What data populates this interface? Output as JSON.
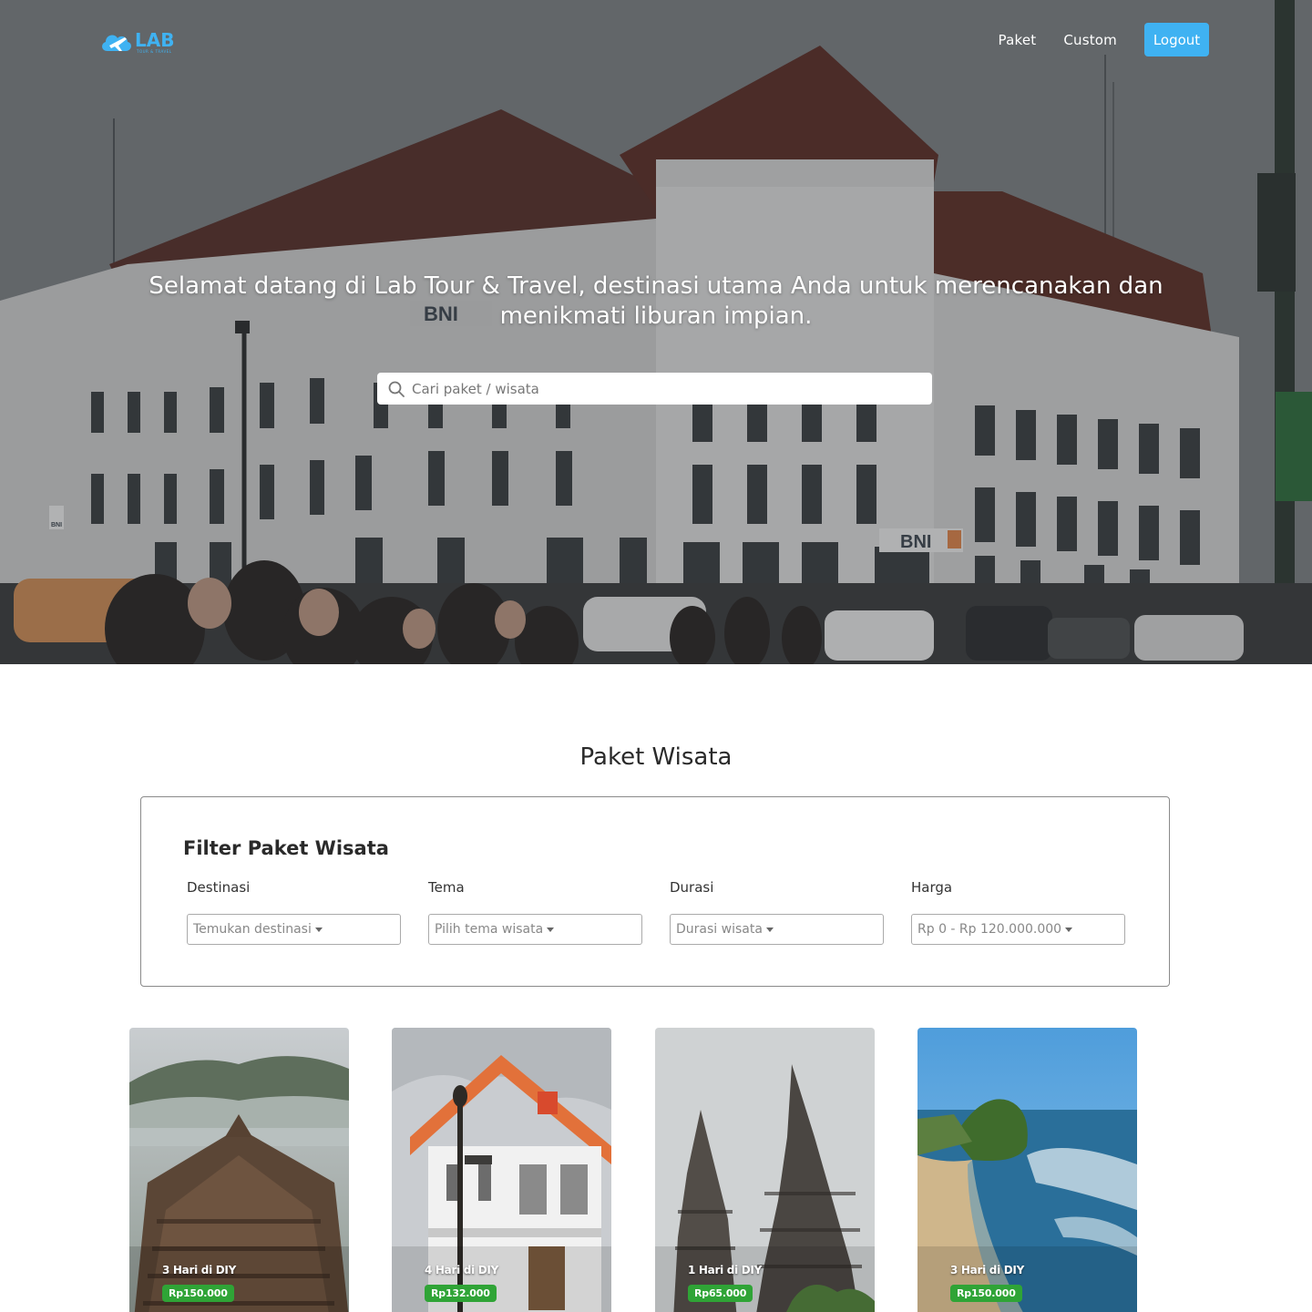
{
  "brand": {
    "name": "LAB",
    "tagline": "TOUR & TRAVEL",
    "accent": "#3fb2f2"
  },
  "nav": {
    "links": [
      {
        "label": "Paket"
      },
      {
        "label": "Custom"
      }
    ],
    "logout_label": "Logout"
  },
  "hero": {
    "title": "Selamat datang di Lab Tour & Travel, destinasi utama Anda untuk merencanakan dan menikmati liburan impian.",
    "search_placeholder": "Cari paket / wisata",
    "background_image_text": [
      "BNI",
      "BNI",
      "BNI"
    ]
  },
  "section": {
    "title": "Paket Wisata"
  },
  "filter": {
    "heading": "Filter Paket Wisata",
    "fields": [
      {
        "label": "Destinasi",
        "value": "Temukan destinasi"
      },
      {
        "label": "Tema",
        "value": "Pilih tema wisata"
      },
      {
        "label": "Durasi",
        "value": "Durasi wisata"
      },
      {
        "label": "Harga",
        "value": "Rp 0 - Rp 120.000.000"
      }
    ]
  },
  "packages": [
    {
      "title": "3 Hari di DIY",
      "price": "Rp150.000"
    },
    {
      "title": "4 Hari di DIY",
      "price": "Rp132.000"
    },
    {
      "title": "1 Hari di DIY",
      "price": "Rp65.000"
    },
    {
      "title": "3 Hari di DIY",
      "price": "Rp150.000"
    }
  ],
  "colors": {
    "price_badge": "#2fa436",
    "logout_button": "#3fb2f2"
  }
}
